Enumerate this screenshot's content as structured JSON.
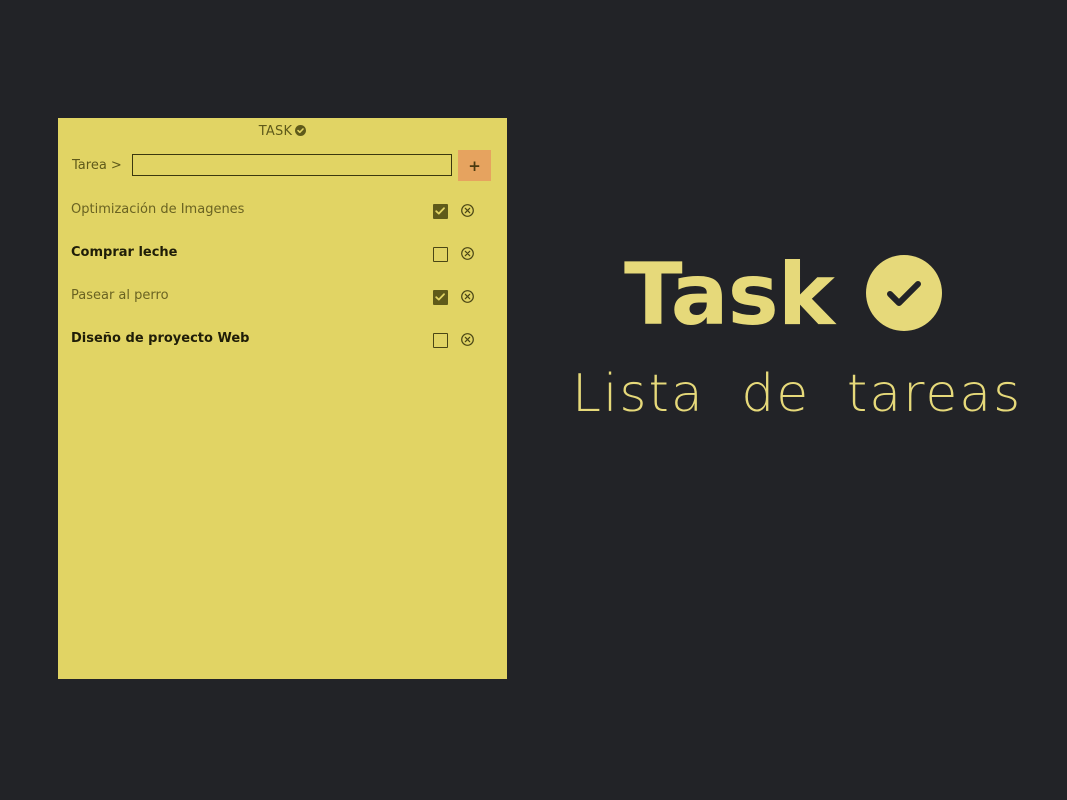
{
  "app": {
    "title": "TASK",
    "title_icon": "check-circle-icon"
  },
  "input": {
    "label": "Tarea >",
    "value": "",
    "add_label": "+"
  },
  "tasks": [
    {
      "text": "Optimización de Imagenes",
      "checked": true
    },
    {
      "text": "Comprar leche",
      "checked": false
    },
    {
      "text": "Pasear al perro",
      "checked": true
    },
    {
      "text": "Diseño de proyecto Web",
      "checked": false
    }
  ],
  "hero": {
    "title": "Task",
    "title_icon": "check-circle-icon",
    "subtitle": "Lista de tareas"
  },
  "colors": {
    "background": "#222327",
    "panel": "#e1d464",
    "accent": "#e6a35f",
    "hero_text": "#e6d97a"
  }
}
